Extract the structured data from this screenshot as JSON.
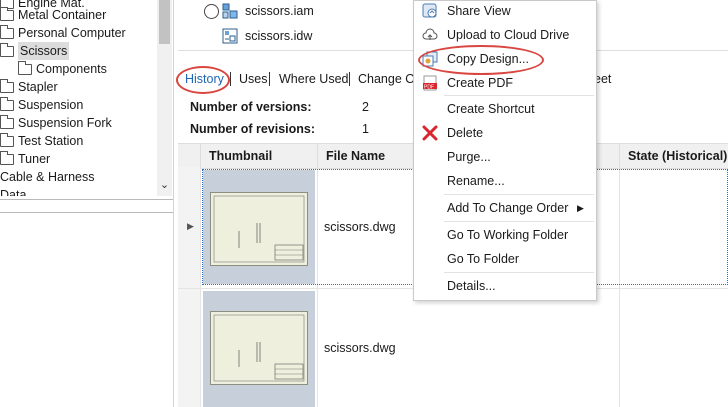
{
  "tree": {
    "items": [
      {
        "label": "Engine Mat.",
        "indent": 1
      },
      {
        "label": "Metal Container",
        "indent": 1
      },
      {
        "label": "Personal Computer",
        "indent": 1
      },
      {
        "label": "Scissors",
        "indent": 1,
        "selected": true
      },
      {
        "label": "Components",
        "indent": 2
      },
      {
        "label": "Stapler",
        "indent": 1
      },
      {
        "label": "Suspension",
        "indent": 1
      },
      {
        "label": "Suspension Fork",
        "indent": 1
      },
      {
        "label": "Test Station",
        "indent": 1
      },
      {
        "label": "Tuner",
        "indent": 1
      },
      {
        "label": "Cable & Harness",
        "indent": 0
      },
      {
        "label": "Data",
        "indent": 0
      }
    ]
  },
  "files": [
    {
      "name": "scissors.iam",
      "icon": "assembly-icon"
    },
    {
      "name": "scissors.idw",
      "icon": "drawing-icon"
    }
  ],
  "tabs": [
    "History",
    "Uses",
    "Where Used",
    "Change Or",
    "eet"
  ],
  "summary": {
    "versions_label": "Number of versions:",
    "versions_value": "2",
    "revisions_label": "Number of revisions:",
    "revisions_value": "1"
  },
  "grid": {
    "headers": [
      "Thumbnail",
      "File Name",
      "State (Historical)"
    ],
    "rows": [
      {
        "file_name": "scissors.dwg"
      },
      {
        "file_name": "scissors.dwg"
      }
    ]
  },
  "context_menu": {
    "items": [
      {
        "label": "Share View",
        "icon": "share-view-icon"
      },
      {
        "label": "Upload to Cloud Drive",
        "icon": "cloud-upload-icon"
      },
      {
        "label": "Copy Design...",
        "icon": "copy-design-icon"
      },
      {
        "label": "Create PDF",
        "icon": "pdf-icon"
      },
      {
        "label": "Create Shortcut",
        "icon": ""
      },
      {
        "label": "Delete",
        "icon": "delete-icon"
      },
      {
        "label": "Purge...",
        "icon": ""
      },
      {
        "label": "Rename...",
        "icon": ""
      },
      {
        "label": "Add To Change Order",
        "icon": "",
        "submenu": true
      },
      {
        "label": "Go To Working Folder",
        "icon": ""
      },
      {
        "label": "Go To Folder",
        "icon": ""
      },
      {
        "label": "Details...",
        "icon": ""
      }
    ]
  },
  "colors": {
    "highlight_ring": "#d9453f",
    "delete_red": "#d9262c",
    "tab_active": "#1f66b4"
  }
}
